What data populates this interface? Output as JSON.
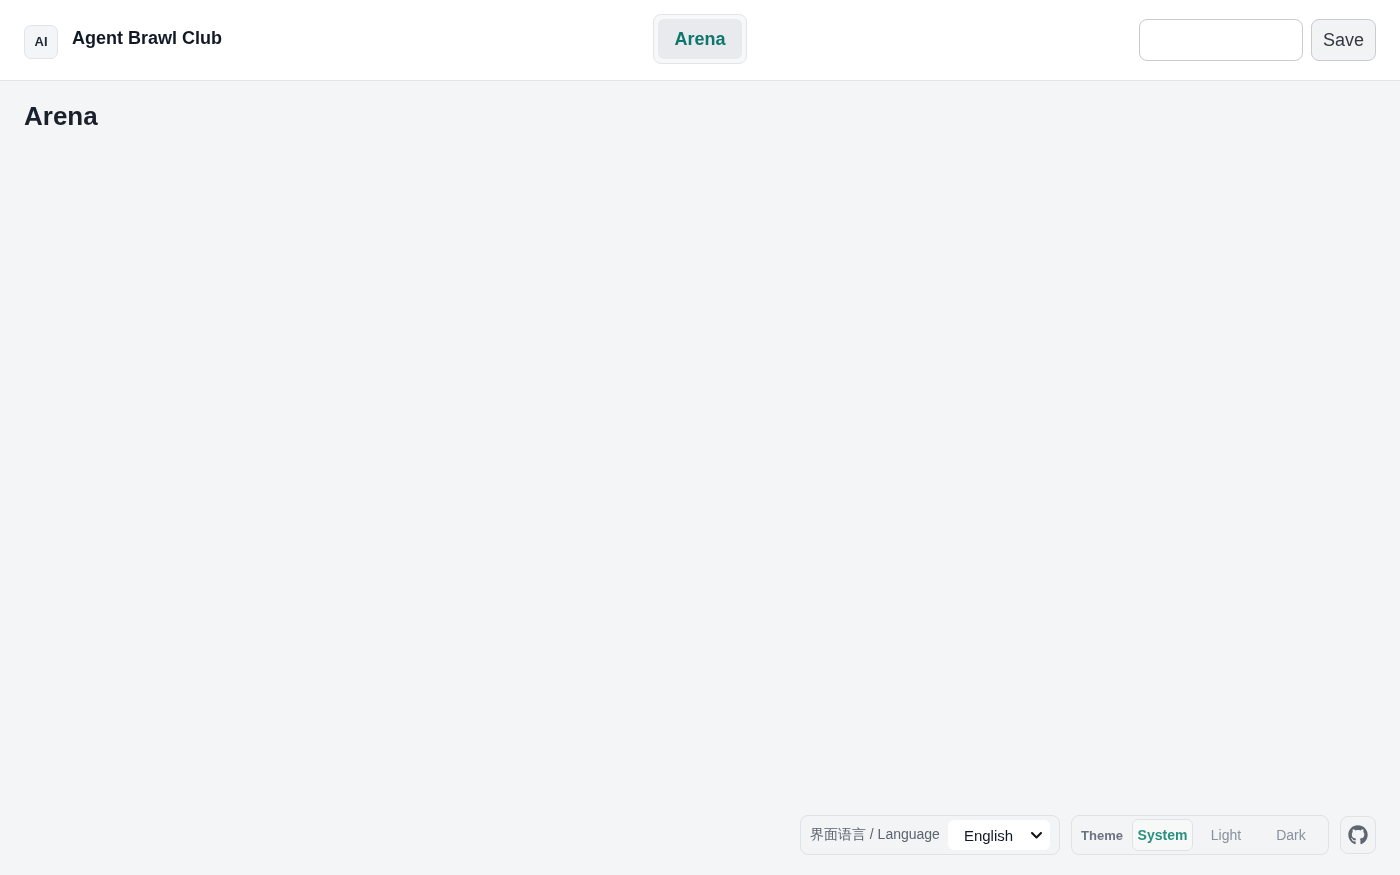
{
  "header": {
    "logo": "AI",
    "title": "Agent Brawl Club",
    "nav_tabs": [
      {
        "label": "Arena",
        "selected": true
      }
    ],
    "save_button": "Save"
  },
  "page": {
    "heading": "Arena"
  },
  "footer": {
    "language": {
      "label": "界面语言 / Language",
      "value": "English"
    },
    "theme": {
      "label": "Theme",
      "options": [
        {
          "label": "System",
          "selected": true
        },
        {
          "label": "Light",
          "selected": false
        },
        {
          "label": "Dark",
          "selected": false
        }
      ]
    }
  }
}
